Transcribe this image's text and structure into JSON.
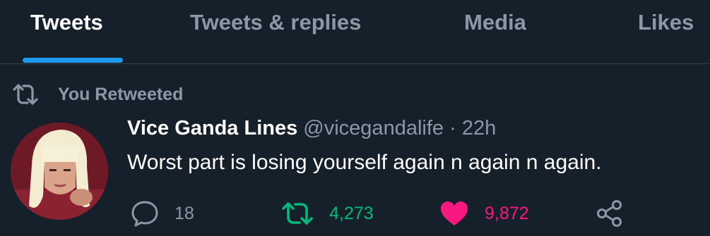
{
  "tabs": [
    {
      "label": "Tweets",
      "active": true
    },
    {
      "label": "Tweets & replies",
      "active": false
    },
    {
      "label": "Media",
      "active": false
    },
    {
      "label": "Likes",
      "active": false
    }
  ],
  "retweet_context": {
    "label": "You Retweeted",
    "icon": "retweet-icon"
  },
  "tweet": {
    "author_name": "Vice Ganda Lines",
    "handle": "@vicegandalife",
    "separator": "·",
    "time": "22h",
    "text": "Worst part is losing yourself again n again n again.",
    "avatar": "profile-photo"
  },
  "actions": {
    "reply": {
      "icon": "reply-icon",
      "count": "18"
    },
    "retweet": {
      "icon": "retweet-icon",
      "count": "4,273",
      "color": "#00ba7c",
      "active": true
    },
    "like": {
      "icon": "heart-icon",
      "count": "9,872",
      "color": "#f91880",
      "active": true
    },
    "share": {
      "icon": "share-icon"
    }
  },
  "colors": {
    "background": "#15202b",
    "text": "#ffffff",
    "muted": "#8b98a5",
    "accent": "#1d9bf0",
    "divider": "#38444d"
  }
}
